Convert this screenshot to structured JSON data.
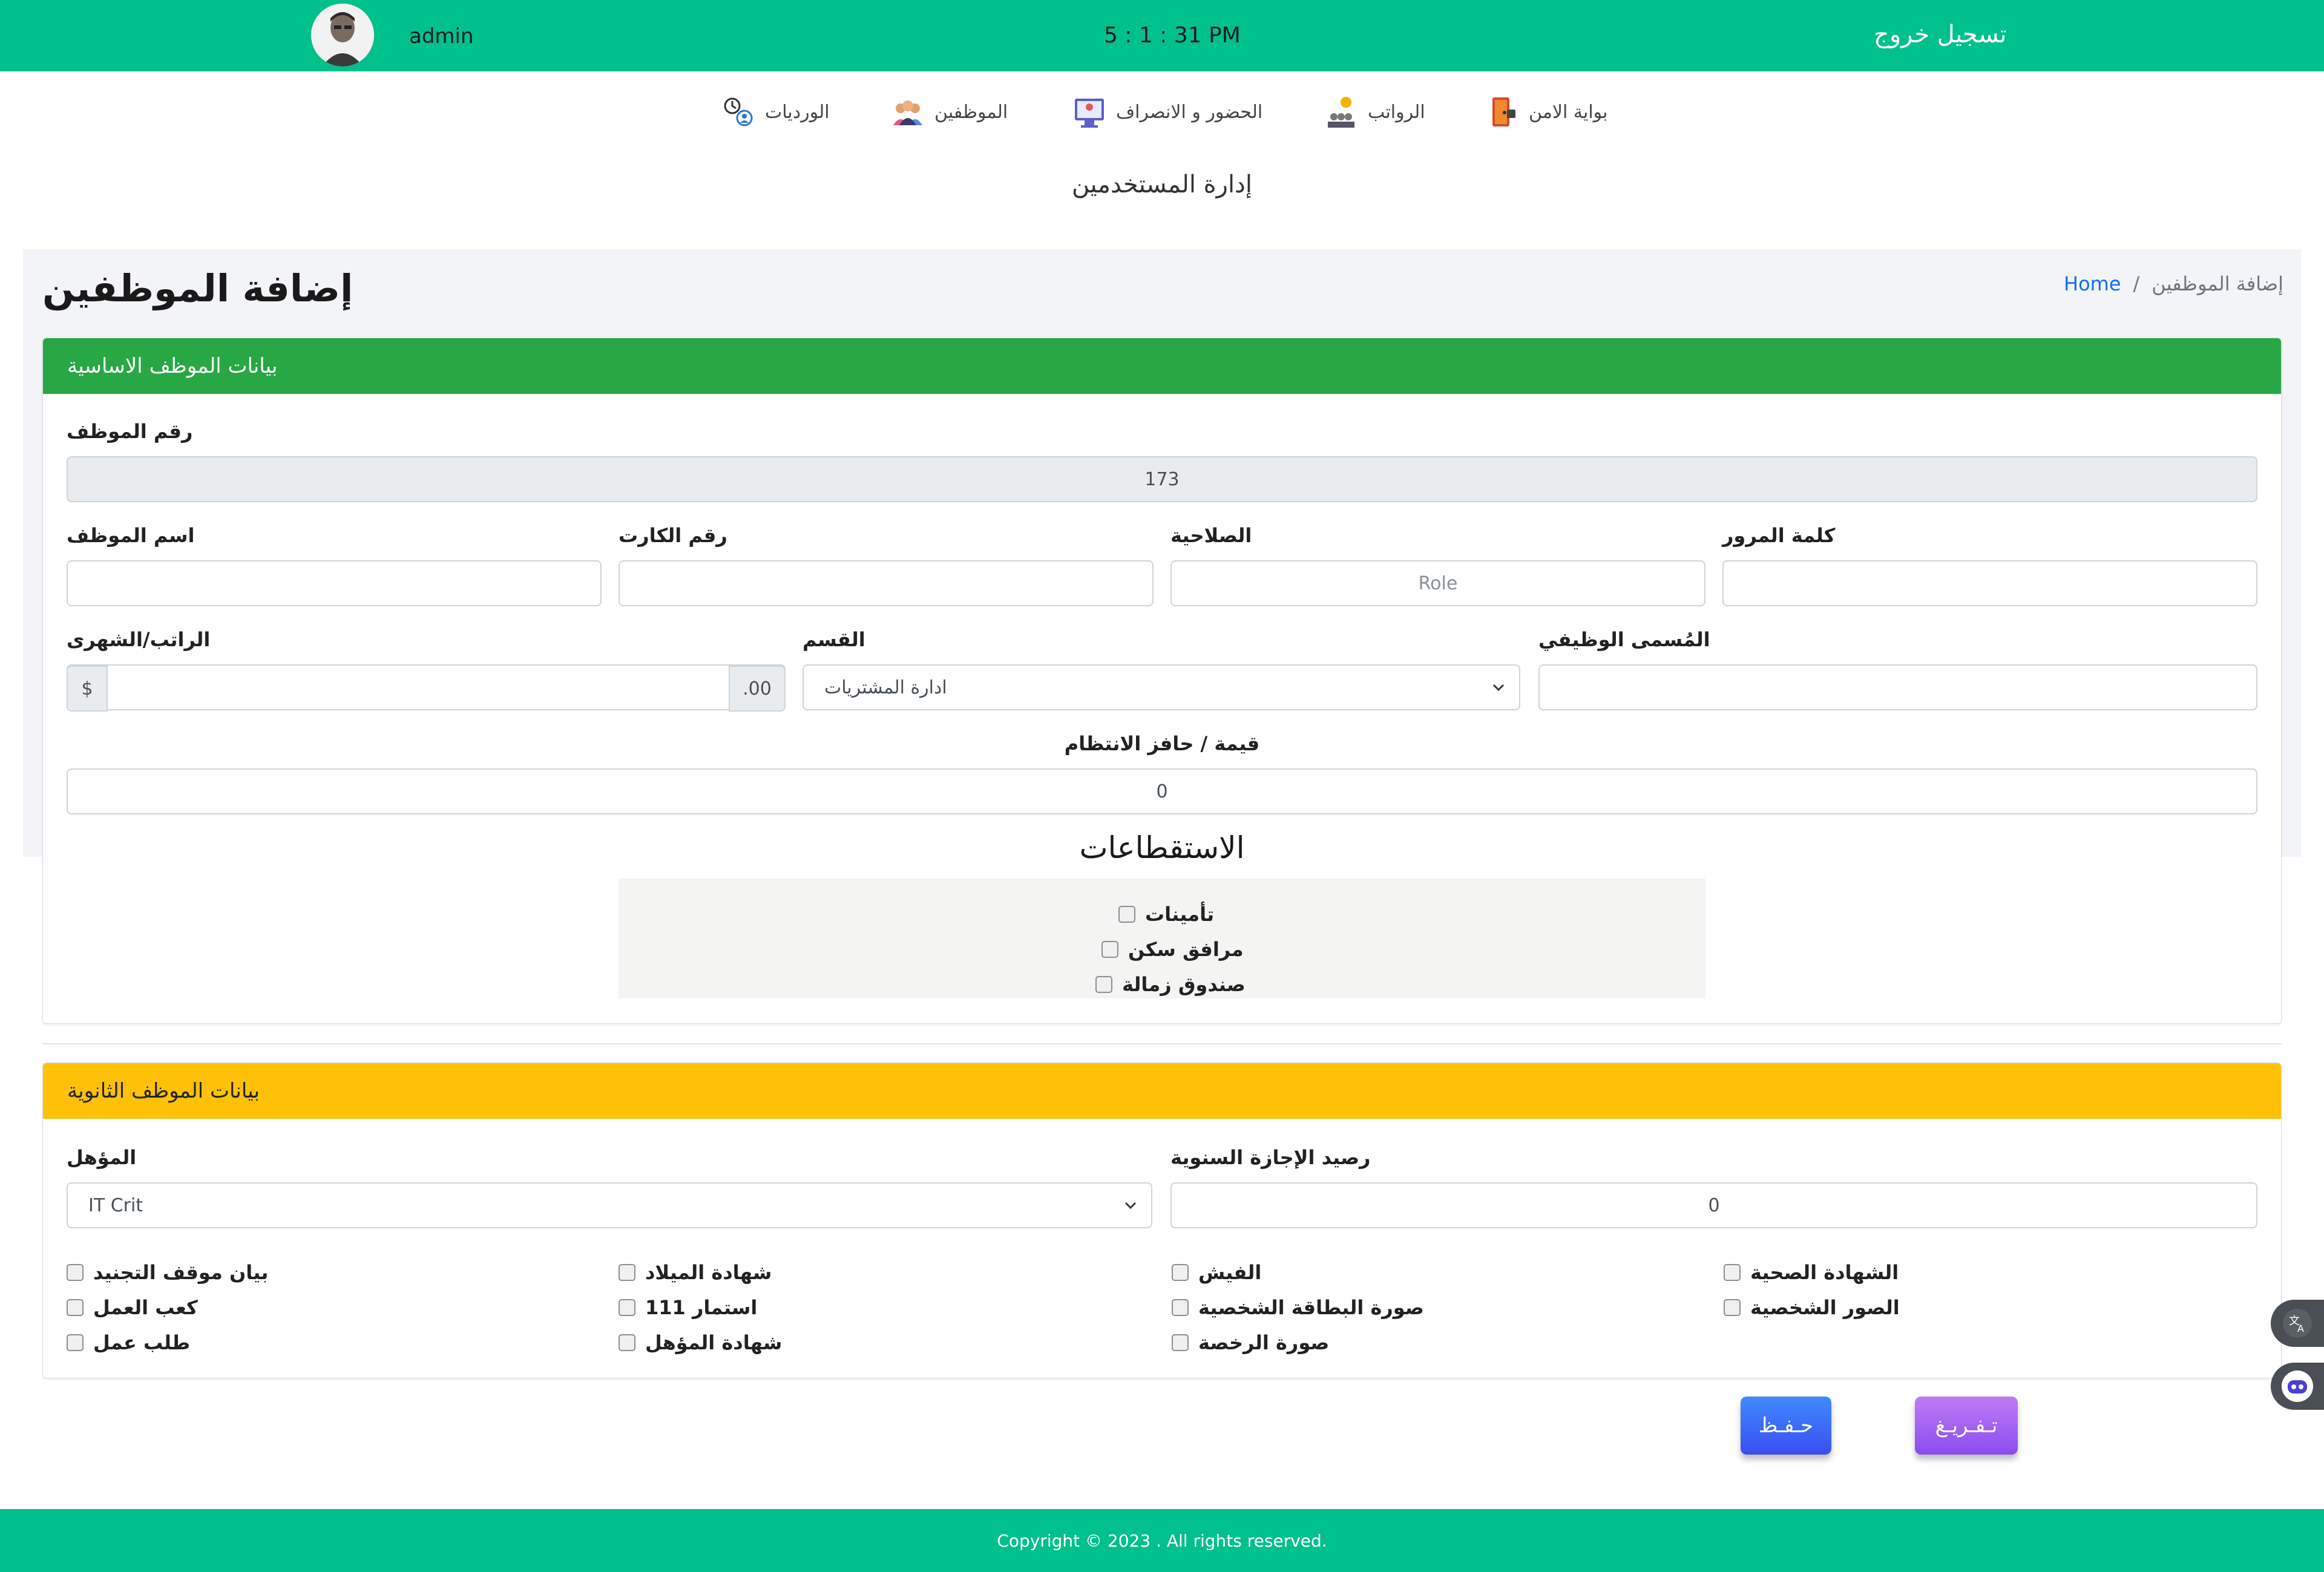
{
  "header": {
    "username": "admin",
    "clock": "5 : 1 : 31 PM",
    "logout_label": "تسجيل خروج"
  },
  "nav": {
    "items": [
      {
        "label": "بواية الامن",
        "icon": "security-gate-icon"
      },
      {
        "label": "الرواتب",
        "icon": "salaries-icon"
      },
      {
        "label": "الحضور و الانصراف",
        "icon": "attendance-icon"
      },
      {
        "label": "الموظفين",
        "icon": "employees-icon"
      },
      {
        "label": "الورديات",
        "icon": "shifts-icon"
      }
    ],
    "subtitle": "إدارة المستخدمين"
  },
  "page": {
    "title": "إضافة الموظفين",
    "breadcrumb_home": "Home",
    "breadcrumb_sep": "/",
    "breadcrumb_current": "إضافة الموظفين"
  },
  "basic": {
    "header": "بيانات الموظف الاساسية",
    "header_color": "#28a745",
    "employee_no_label": "رقم الموظف",
    "employee_no_value": "173",
    "name_label": "اسم الموظف",
    "card_no_label": "رقم الكارت",
    "role_label": "الصلاحية",
    "role_placeholder": "Role",
    "password_label": "كلمة المرور",
    "salary_label": "الراتب/الشهرى",
    "salary_prefix": "$",
    "salary_suffix": ".00",
    "department_label": "القسم",
    "department_value": "ادارة المشتريات",
    "job_title_label": "المُسمى الوظيفي",
    "bonus_label": "قيمة / حافز الانتظام",
    "bonus_value": "0"
  },
  "deductions": {
    "title": "الاستقطاعات",
    "items": [
      "تأمينات",
      "مرافق سكن",
      "صندوق زمالة"
    ]
  },
  "secondary": {
    "header": "بيانات الموظف الثانوية",
    "header_color": "#ffc107",
    "qualification_label": "المؤهل",
    "qualification_value": "IT Crit",
    "leave_label": "رصيد الإجازة السنوية",
    "leave_value": "0",
    "docs": [
      [
        "بيان موقف التجنيد",
        "كعب العمل",
        "طلب عمل"
      ],
      [
        "شهادة الميلاد",
        "استمار 111",
        "شهادة المؤهل"
      ],
      [
        "الفيش",
        "صورة البطاقة الشخصية",
        "صورة الرخصة"
      ],
      [
        "الشهادة الصحية",
        "الصور الشخصية"
      ]
    ]
  },
  "actions": {
    "save_label": "حـفـظ",
    "clear_label": "تـفـريـغ"
  },
  "footer": {
    "copyright": "Copyright © 2023 . All rights reserved."
  },
  "colors": {
    "topbar": "#00c08b",
    "save_button": "#3a5cf5",
    "clear_button": "#a45cf0"
  }
}
